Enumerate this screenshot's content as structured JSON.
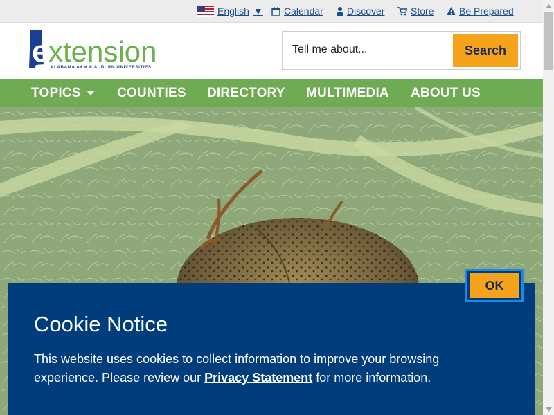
{
  "utility_bar": {
    "language": "English",
    "language_caret": "▼",
    "links": [
      {
        "label": "Calendar",
        "icon": "calendar-icon"
      },
      {
        "label": "Discover",
        "icon": "person-icon"
      },
      {
        "label": "Store",
        "icon": "cart-icon"
      },
      {
        "label": "Be Prepared",
        "icon": "warning-icon"
      }
    ]
  },
  "header": {
    "logo_text": "extension",
    "logo_subtext": "ALABAMA A&M & AUBURN UNIVERSITIES",
    "search": {
      "placeholder": "Tell me about...",
      "button_label": "Search"
    }
  },
  "nav": {
    "items": [
      "TOPICS",
      "COUNTIES",
      "DIRECTORY",
      "MULTIMEDIA",
      "ABOUT US"
    ]
  },
  "hero": {
    "prev_arrow": "‹"
  },
  "cookie_notice": {
    "title": "Cookie Notice",
    "text_before": "This website uses cookies to collect information to improve your browsing experience. Please review our ",
    "link_label": "Privacy Statement",
    "text_after": " for more information.",
    "ok_label": "OK"
  },
  "colors": {
    "nav_green": "#6fab52",
    "accent_orange": "#f5a31a",
    "cookie_blue": "#003d7c",
    "brand_navy": "#1c3f94",
    "logo_green": "#6ab04c"
  }
}
